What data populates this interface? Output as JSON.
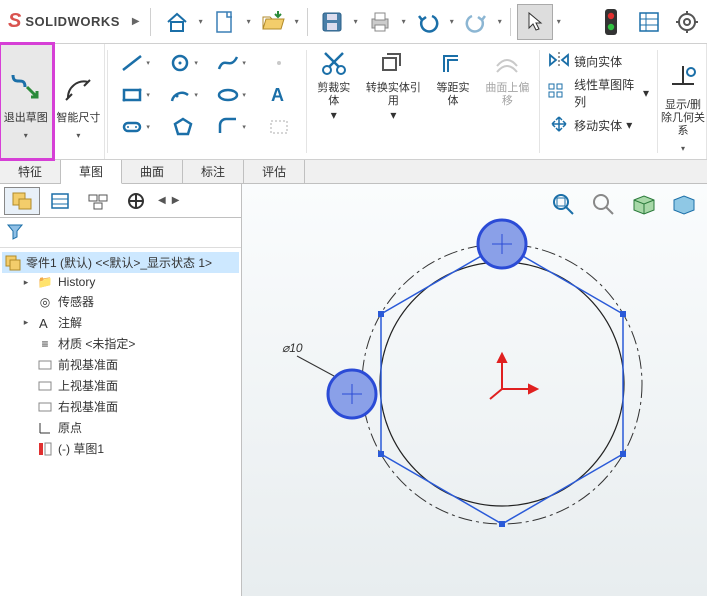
{
  "app": {
    "name": "SOLIDWORKS"
  },
  "qat": {
    "arrow": "▼"
  },
  "ribbon": {
    "exit_sketch": "退出草图",
    "smart_dim": "智能尺寸",
    "trim": "剪裁实体",
    "convert": "转换实体引用",
    "offset": "等距实体",
    "surface_offset": "曲面上偏移",
    "mirror": "镜向实体",
    "linear_pattern": "线性草图阵列",
    "move": "移动实体",
    "display_rel": "显示/删除几何关系"
  },
  "tabs": [
    "特征",
    "草图",
    "曲面",
    "标注",
    "评估"
  ],
  "tree": {
    "root": "零件1 (默认) <<默认>_显示状态 1>",
    "history": "History",
    "sensors": "传感器",
    "annotations": "注解",
    "material": "材质 <未指定>",
    "front": "前视基准面",
    "top": "上视基准面",
    "right": "右视基准面",
    "origin": "原点",
    "sketch1": "(-) 草图1"
  },
  "sketch": {
    "dim": "⌀10"
  },
  "chart_data": {
    "type": "other",
    "description": "CAD sketch: hexagon circumscribing a circle (diameter dimensioned ⌀10), with two small selected circles on the top and left-lower vertices of the circle; origin triad at center (red)."
  },
  "colors": {
    "accent": "#1b6fa8",
    "sel": "#2b4bd6",
    "origin": "#e02020",
    "hex": "#2a5ad8"
  }
}
